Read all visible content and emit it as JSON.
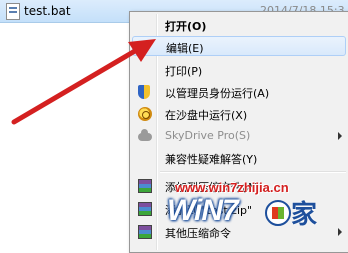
{
  "explorer": {
    "file_name": "test.bat",
    "file_date": "2014/7/18 15:3"
  },
  "context_menu": {
    "items": [
      {
        "label": "打开(O)",
        "icon": "none",
        "bold": true
      },
      {
        "label": "编辑(E)",
        "icon": "none",
        "highlighted": true
      },
      {
        "label": "打印(P)",
        "icon": "none"
      },
      {
        "label": "以管理员身份运行(A)",
        "icon": "uac-shield-icon"
      },
      {
        "label": "在沙盘中运行(X)",
        "icon": "sandbox-icon"
      },
      {
        "label": "SkyDrive Pro(S)",
        "icon": "cloud-icon",
        "submenu": true,
        "disabled": true
      },
      {
        "label": "兼容性疑难解答(Y)",
        "icon": "none"
      },
      {
        "label": "添加到压缩文件(A)...",
        "icon": "winrar-icon"
      },
      {
        "label": "添加到 \"test.zip\"",
        "icon": "winrar-icon"
      },
      {
        "label": "其他压缩命令",
        "icon": "winrar-icon",
        "submenu": true
      }
    ]
  },
  "watermark": {
    "url": "www.win7zhijia.cn",
    "logo": "WiN7",
    "suffix": "家"
  },
  "colors": {
    "menu_background": "#f1f1f1",
    "highlight": "#d9e9fb",
    "annotation_arrow": "#d42020",
    "selection_row": "#cce4fa"
  }
}
